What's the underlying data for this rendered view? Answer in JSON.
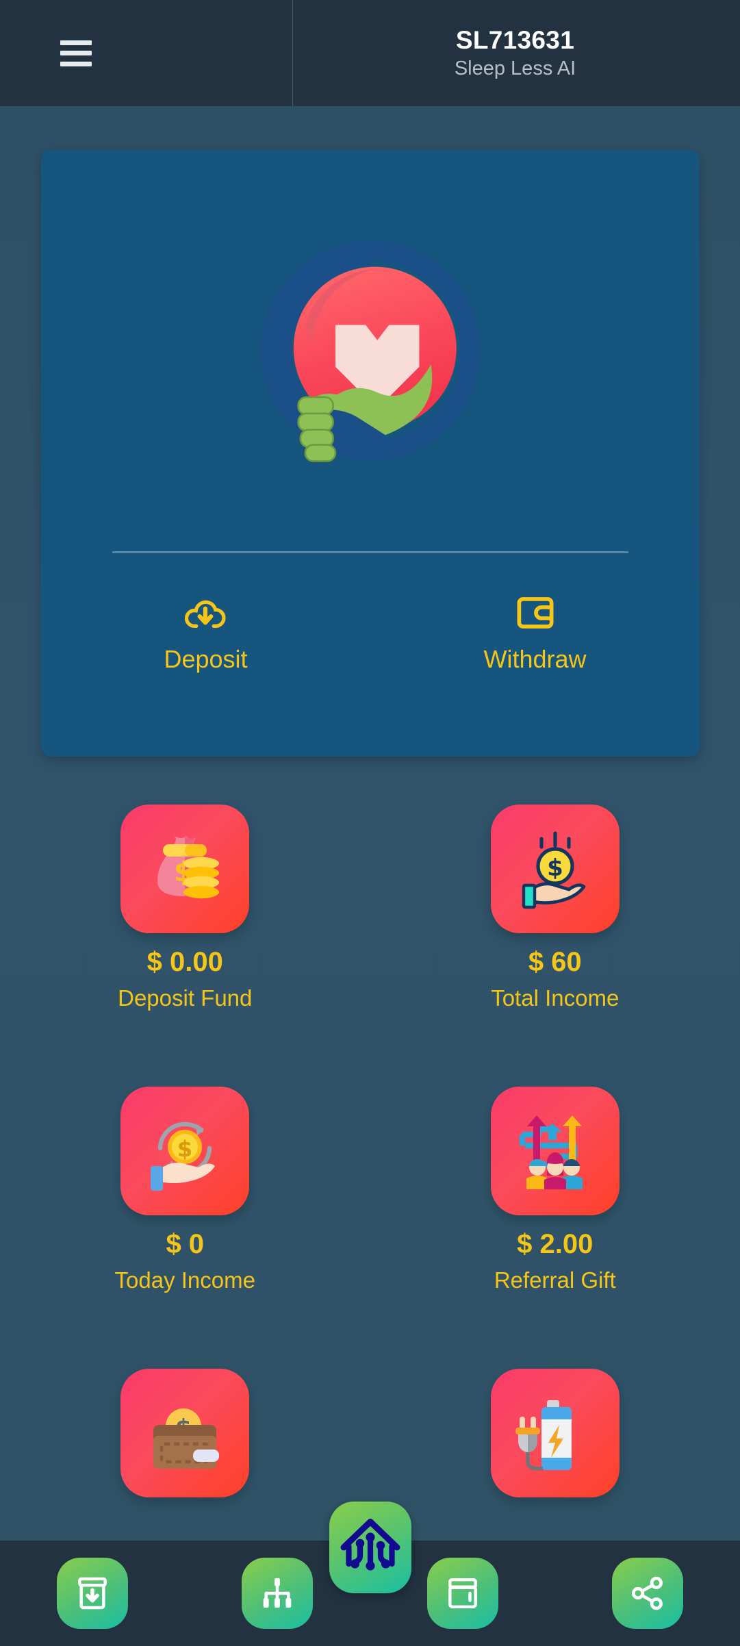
{
  "header": {
    "menu_icon": "hamburger-menu-icon",
    "account_id": "SL713631",
    "app_name": "Sleep Less AI"
  },
  "balance_card": {
    "logo_icon": "hands-holding-heart-logo",
    "actions": [
      {
        "label": "Deposit",
        "icon": "cloud-download-icon"
      },
      {
        "label": "Withdraw",
        "icon": "wallet-icon"
      }
    ]
  },
  "stats": [
    {
      "value": "$ 0.00",
      "label": "Deposit Fund",
      "icon": "money-bag-coins-icon"
    },
    {
      "value": "$ 60",
      "label": "Total Income",
      "icon": "hand-dollar-coin-icon"
    },
    {
      "value": "$ 0",
      "label": "Today Income",
      "icon": "hand-recycle-coin-icon"
    },
    {
      "value": "$ 2.00",
      "label": "Referral Gift",
      "icon": "referral-people-network-icon"
    },
    {
      "value": "",
      "label": "",
      "icon": "wallet-coin-icon"
    },
    {
      "value": "",
      "label": "",
      "icon": "battery-charging-plug-icon"
    }
  ],
  "bottom_nav": [
    {
      "icon": "archive-download-icon"
    },
    {
      "icon": "team-hierarchy-icon"
    },
    {
      "icon": "home-circuit-logo-icon"
    },
    {
      "icon": "wallet-nav-icon"
    },
    {
      "icon": "share-nodes-icon"
    }
  ],
  "colors": {
    "page_background": "#2f5165",
    "appbar": "#223241",
    "card": "#15557e",
    "accent_gold": "#f5c518",
    "tile_red": "#fb3b6b",
    "nav_green": "#4cbf7a",
    "logo_navy": "#120a8f"
  }
}
